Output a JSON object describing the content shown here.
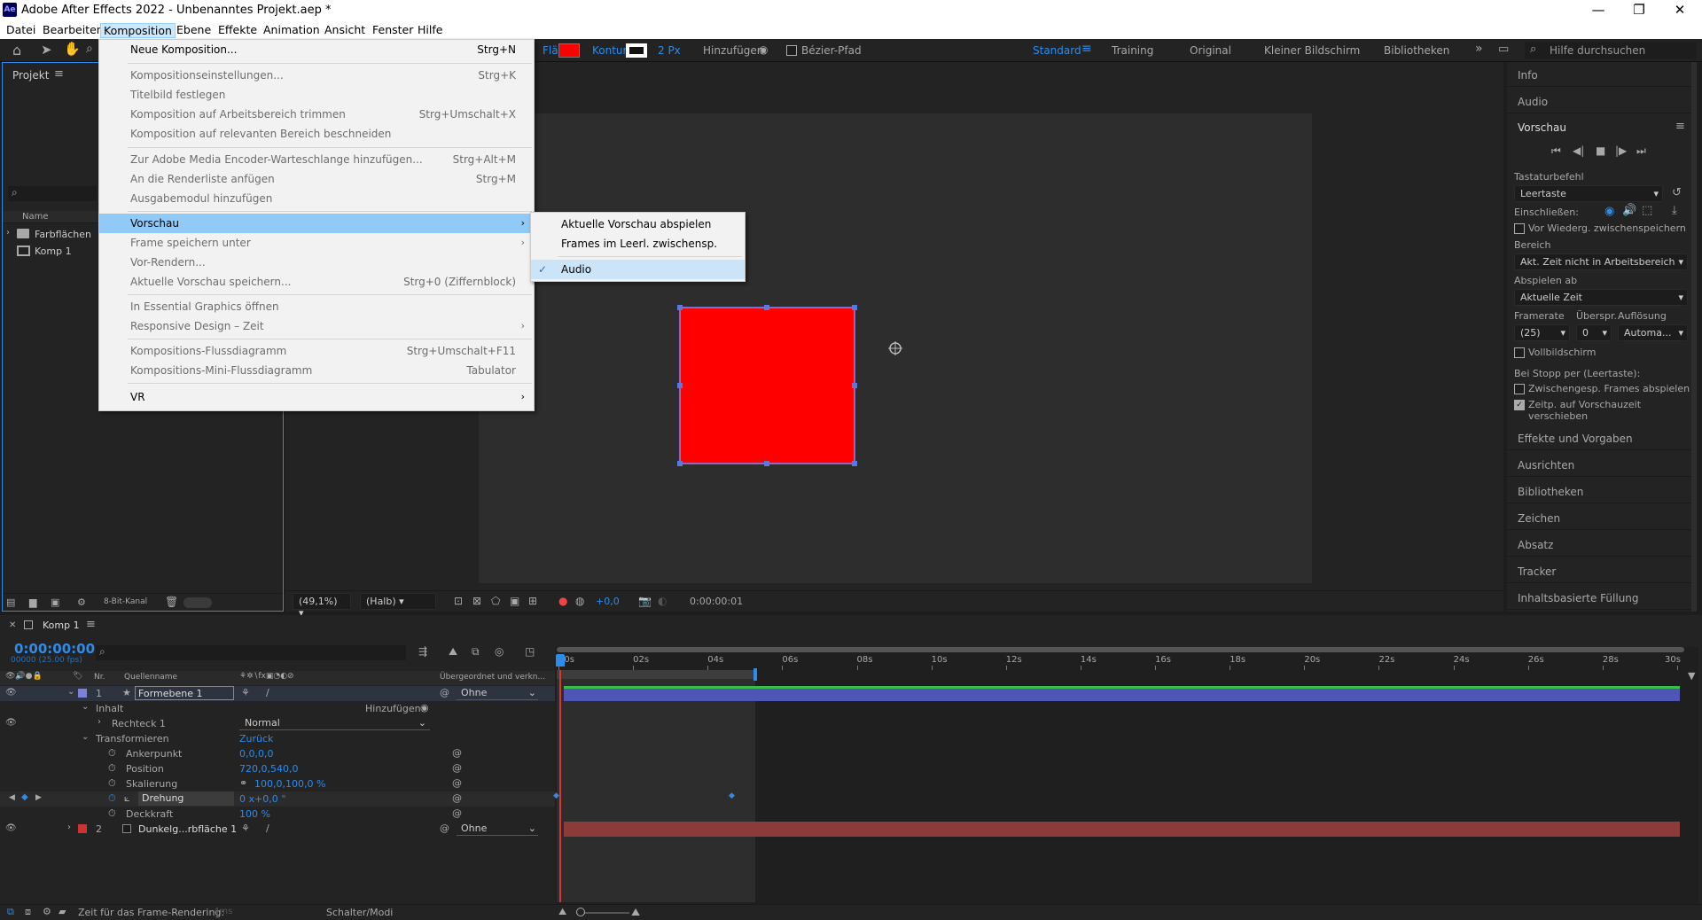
{
  "title": "Adobe After Effects 2022 - Unbenanntes Projekt.aep *",
  "menus": [
    "Datei",
    "Bearbeiten",
    "Komposition",
    "Ebene",
    "Effekte",
    "Animation",
    "Ansicht",
    "Fenster",
    "Hilfe"
  ],
  "toolbar": {
    "fill_label": "Fläche:",
    "stroke_label": "Kontur:",
    "stroke_width": "2 Px",
    "add_label": "Hinzufügen:",
    "bezier_label": "Bézier-Pfad",
    "workspaces": [
      "Standard",
      "Training",
      "Original",
      "Kleiner Bildschirm",
      "Bibliotheken"
    ],
    "help_placeholder": "Hilfe durchsuchen",
    "fill_color": "#ff0000"
  },
  "komp_menu": [
    {
      "label": "Neue Komposition...",
      "shortcut": "Strg+N",
      "enabled": true
    },
    {
      "label": "Kompositionseinstellungen...",
      "shortcut": "Strg+K",
      "enabled": false
    },
    {
      "label": "Titelbild festlegen",
      "shortcut": "",
      "enabled": false
    },
    {
      "label": "Komposition auf Arbeitsbereich trimmen",
      "shortcut": "Strg+Umschalt+X",
      "enabled": false
    },
    {
      "label": "Komposition auf relevanten Bereich beschneiden",
      "shortcut": "",
      "enabled": false
    },
    {
      "label": "Zur Adobe Media Encoder-Warteschlange hinzufügen...",
      "shortcut": "Strg+Alt+M",
      "enabled": false
    },
    {
      "label": "An die Renderliste anfügen",
      "shortcut": "Strg+M",
      "enabled": false
    },
    {
      "label": "Ausgabemodul hinzufügen",
      "shortcut": "",
      "enabled": false
    },
    {
      "label": "Vorschau",
      "shortcut": "",
      "enabled": true
    },
    {
      "label": "Frame speichern unter",
      "shortcut": "",
      "enabled": false
    },
    {
      "label": "Vor-Rendern...",
      "shortcut": "",
      "enabled": false
    },
    {
      "label": "Aktuelle Vorschau speichern...",
      "shortcut": "Strg+0 (Ziffernblock)",
      "enabled": false
    },
    {
      "label": "In Essential Graphics öffnen",
      "shortcut": "",
      "enabled": false
    },
    {
      "label": "Responsive Design – Zeit",
      "shortcut": "",
      "enabled": false
    },
    {
      "label": "Kompositions-Flussdiagramm",
      "shortcut": "Strg+Umschalt+F11",
      "enabled": false
    },
    {
      "label": "Kompositions-Mini-Flussdiagramm",
      "shortcut": "Tabulator",
      "enabled": false
    },
    {
      "label": "VR",
      "shortcut": "",
      "enabled": true
    }
  ],
  "preview_submenu": [
    "Aktuelle Vorschau abspielen",
    "Frames im Leerl. zwischensp.",
    "Audio"
  ],
  "project": {
    "title": "Projekt",
    "col_name": "Name",
    "items": [
      "Farbflächen",
      "Komp 1"
    ],
    "bitdepth": "8-Bit-Kanal"
  },
  "viewer": {
    "zoom": "(49,1%)",
    "resolution": "(Halb)",
    "exposure": "+0,0",
    "timecode": "0:00:00:01",
    "shape_color": "#ff0000"
  },
  "right": {
    "info": "Info",
    "audio": "Audio",
    "preview": "Vorschau",
    "shortcut_label": "Tastaturbefehl",
    "shortcut_value": "Leertaste",
    "include_label": "Einschließen:",
    "cache_label": "Vor Wiederg. zwischenspeichern",
    "range_label": "Bereich",
    "range_value": "Akt. Zeit nicht in Arbeitsbereich",
    "play_from_label": "Abspielen ab",
    "play_from_value": "Aktuelle Zeit",
    "framerate_label": "Framerate",
    "skip_label": "Überspr.",
    "resolution_label": "Auflösung",
    "framerate_value": "(25)",
    "skip_value": "0",
    "resolution_value": "Automa...",
    "fullscreen_label": "Vollbildschirm",
    "stop_label": "Bei Stopp per (Leertaste):",
    "play_cached_label": "Zwischengesp. Frames abspielen",
    "move_time_label": "Zeitp. auf Vorschauzeit verschieben",
    "panels": [
      "Effekte und Vorgaben",
      "Ausrichten",
      "Bibliotheken",
      "Zeichen",
      "Absatz",
      "Tracker",
      "Inhaltsbasierte Füllung"
    ]
  },
  "timeline": {
    "tab": "Komp 1",
    "timecode": "0:00:00:00",
    "fps": "00000 (25.00 fps)",
    "col_nr": "Nr.",
    "col_source": "Quellenname",
    "col_parent": "Übergeordnet und verkn...",
    "ruler": [
      "00s",
      "02s",
      "04s",
      "06s",
      "08s",
      "10s",
      "12s",
      "14s",
      "16s",
      "18s",
      "20s",
      "22s",
      "24s",
      "26s",
      "28s",
      "30s"
    ],
    "layer1": {
      "nr": "1",
      "name": "Formebene 1",
      "parent": "Ohne"
    },
    "content_label": "Inhalt",
    "add_label": "Hinzufügen:",
    "rect_label": "Rechteck 1",
    "blend_mode": "Normal",
    "transform_label": "Transformieren",
    "reset_label": "Zurück",
    "props": [
      {
        "name": "Ankerpunkt",
        "value": "0,0,0,0"
      },
      {
        "name": "Position",
        "value": "720,0,540,0"
      },
      {
        "name": "Skalierung",
        "value": "100,0,100,0 %"
      },
      {
        "name": "Drehung",
        "value": "0 x+0,0 °"
      },
      {
        "name": "Deckkraft",
        "value": "100 %"
      }
    ],
    "layer2": {
      "nr": "2",
      "name": "Dunkelg...rbfläche 1",
      "parent": "Ohne"
    },
    "status_label": "Zeit für das Frame-Rendering:",
    "status_value": "4ms",
    "switches_label": "Schalter/Modi"
  }
}
